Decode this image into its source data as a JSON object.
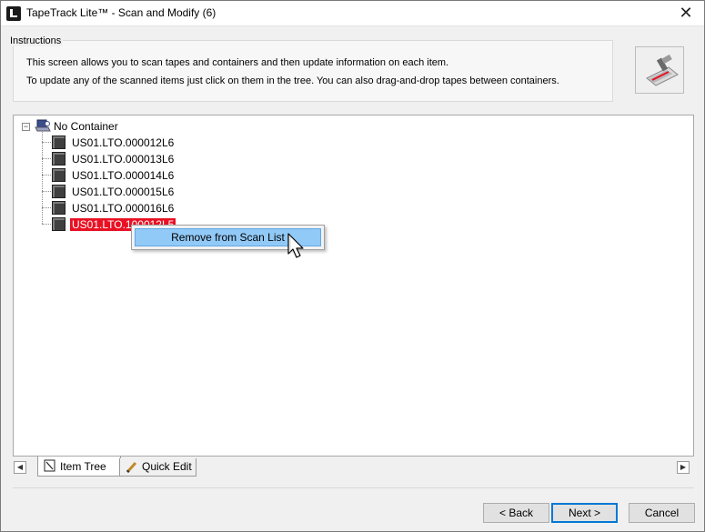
{
  "window": {
    "title": "TapeTrack Lite™ - Scan and Modify (6)",
    "close_glyph": "✕"
  },
  "instructions": {
    "legend": "Instructions",
    "line1": "This screen allows you to scan tapes and containers and then update information on each item.",
    "line2": "To update any of the scanned items just click on them in the tree. You can also drag-and-drop tapes between containers."
  },
  "tree": {
    "root_expander": "⊟",
    "root_label": "No Container",
    "items": [
      {
        "label": "US01.LTO.000012L6"
      },
      {
        "label": "US01.LTO.000013L6"
      },
      {
        "label": "US01.LTO.000014L6"
      },
      {
        "label": "US01.LTO.000015L6"
      },
      {
        "label": "US01.LTO.000016L6"
      },
      {
        "label": "US01.LTO.100012L5"
      }
    ],
    "selected_index": 5
  },
  "context_menu": {
    "items": [
      {
        "label": "Remove from Scan List"
      }
    ]
  },
  "tabs": [
    {
      "label": "Item Tree",
      "icon": "item-tree-icon",
      "active": true
    },
    {
      "label": "Quick Edit",
      "icon": "pencil-icon",
      "active": false
    }
  ],
  "scroll": {
    "left_glyph": "◀",
    "right_glyph": "▶"
  },
  "footer": {
    "back_label": "< Back",
    "next_label": "Next >",
    "cancel_label": "Cancel"
  },
  "colors": {
    "selection": "#e81123",
    "menu_highlight": "#91c9f7",
    "default_button_border": "#0078d7"
  }
}
